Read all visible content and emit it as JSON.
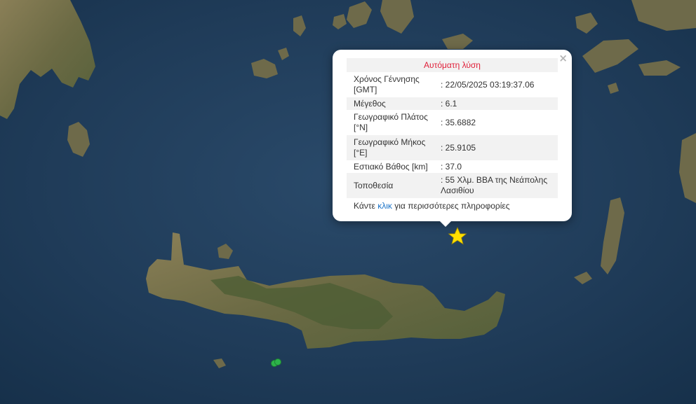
{
  "popup": {
    "title": "Αυτόματη λύση",
    "close_icon": "×",
    "rows": [
      {
        "label": "Χρόνος Γέννησης [GMT]",
        "value": ": 22/05/2025 03:19:37.06"
      },
      {
        "label": "Μέγεθος",
        "value": ": 6.1"
      },
      {
        "label": "Γεωγραφικό Πλάτος [°N]",
        "value": ": 35.6882"
      },
      {
        "label": "Γεωγραφικό Μήκος [°E]",
        "value": ": 25.9105"
      },
      {
        "label": "Εστιακό Βάθος [km]",
        "value": ": 37.0"
      },
      {
        "label": "Τοποθεσία",
        "value": ": 55 Χλμ. ΒΒΑ της Νεάπολης Λασιθίου"
      }
    ],
    "more_prefix": "Κάντε",
    "more_link": "κλικ",
    "more_suffix": "για περισσότερες πληροφορίες"
  },
  "markers": {
    "epicenter_icon": "star-icon",
    "epicenter_color": "#ffe000",
    "event_color": "#2db34a"
  },
  "colors": {
    "sea": "#1e3a57",
    "land": "#6e6a4a",
    "land_green": "#4e5e34"
  }
}
